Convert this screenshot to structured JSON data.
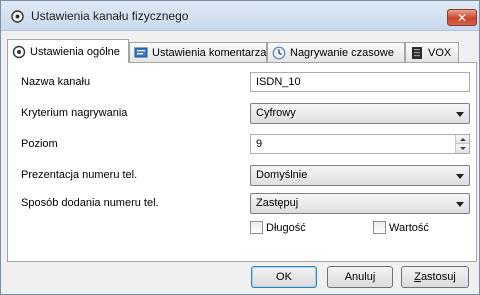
{
  "window": {
    "title": "Ustawienia kanału fizycznego",
    "close_glyph": "✕"
  },
  "tabs": [
    {
      "label": "Ustawienia ogólne",
      "icon": "settings-icon"
    },
    {
      "label": "Ustawienia komentarza",
      "icon": "comment-icon"
    },
    {
      "label": "Nagrywanie czasowe",
      "icon": "clock-icon"
    },
    {
      "label": "VOX",
      "icon": "vox-icon"
    }
  ],
  "form": {
    "channel_name": {
      "label": "Nazwa kanału",
      "value": "ISDN_10"
    },
    "recording_criterion": {
      "label": "Kryterium nagrywania",
      "value": "Cyfrowy"
    },
    "level": {
      "label": "Poziom",
      "value": "9"
    },
    "number_presentation": {
      "label": "Prezentacja numeru tel.",
      "value": "Domyślnie"
    },
    "number_add_method": {
      "label": "Sposób dodania numeru tel.",
      "value": "Zastępuj"
    },
    "length_checkbox": {
      "label": "Długość",
      "checked": false
    },
    "value_checkbox": {
      "label": "Wartość",
      "checked": false
    }
  },
  "buttons": {
    "ok": "OK",
    "cancel": "Anuluj",
    "apply": "Zastosuj"
  },
  "colors": {
    "titlebar": "#c9d9ee",
    "close": "#c9452c",
    "panel": "#ffffff",
    "dialog": "#f0f0f0"
  }
}
